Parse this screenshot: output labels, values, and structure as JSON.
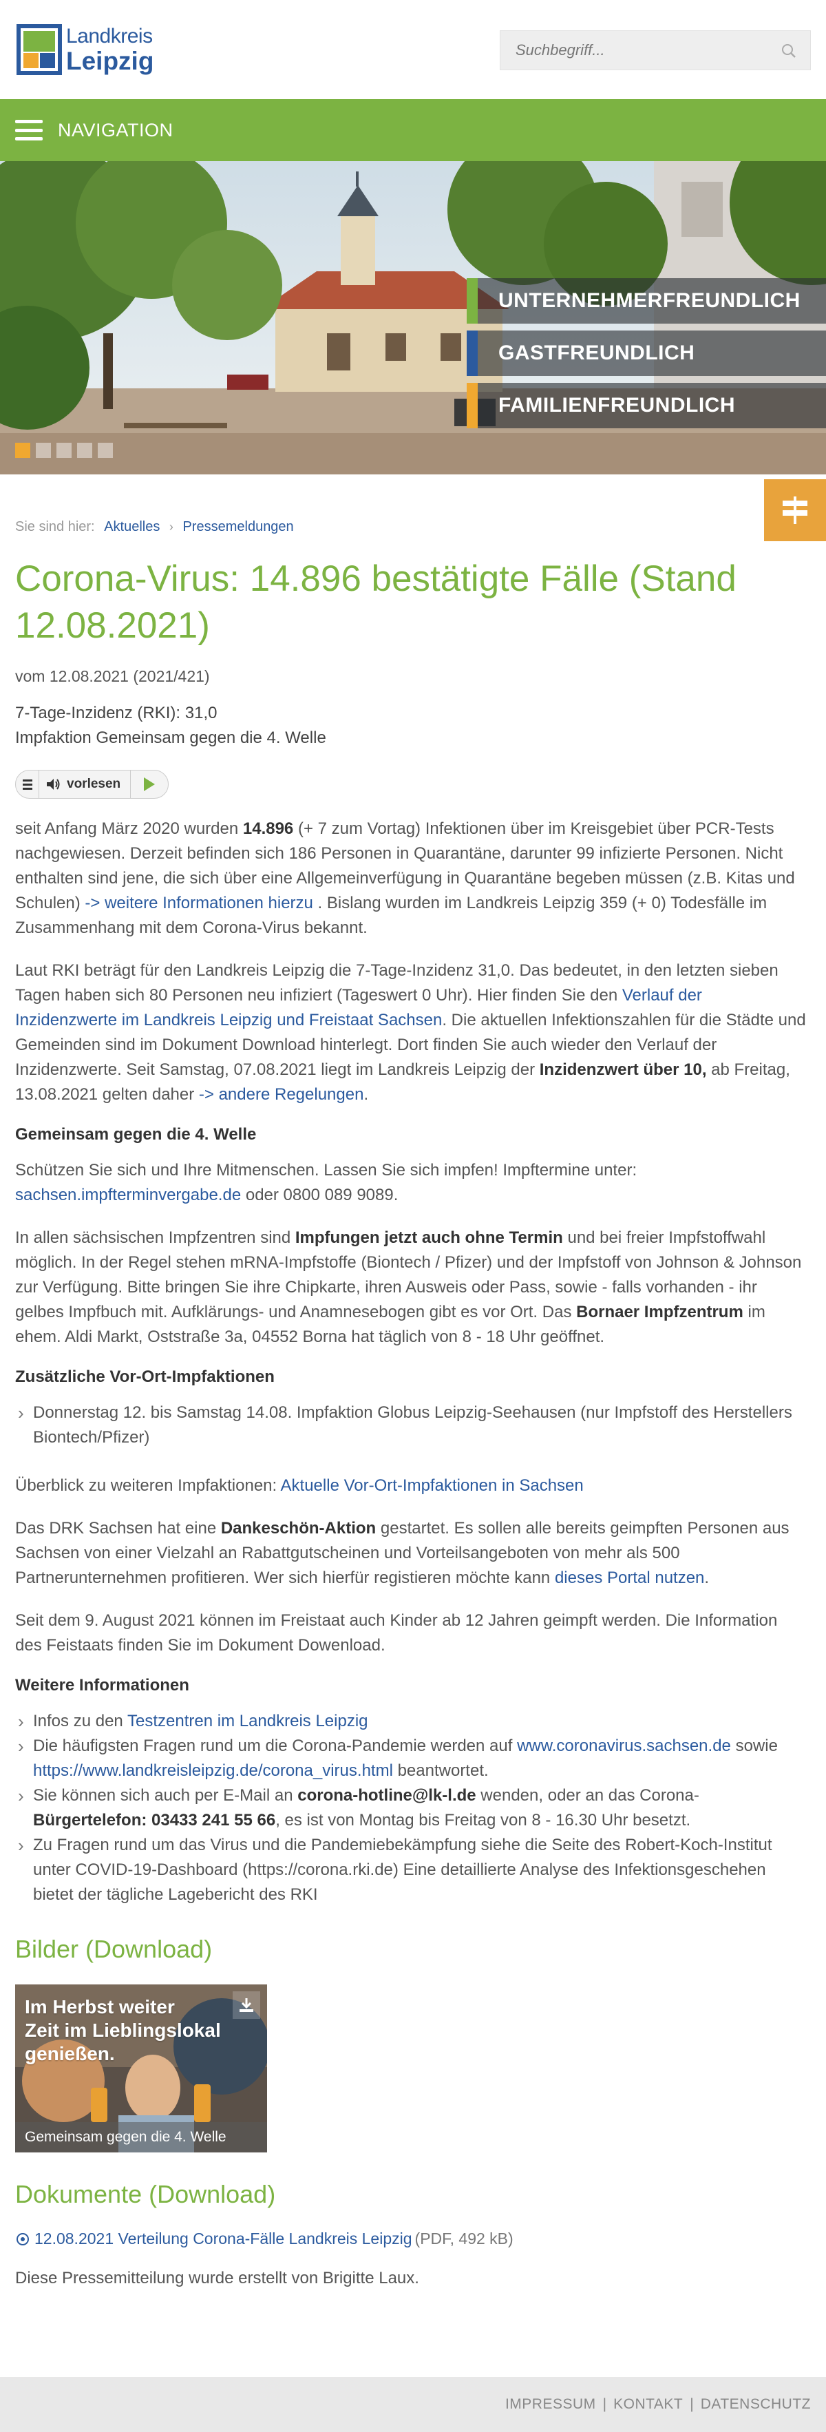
{
  "header": {
    "logo_line1": "Landkreis",
    "logo_line2": "Leipzig",
    "search_placeholder": "Suchbegriff..."
  },
  "nav": {
    "label": "NAVIGATION"
  },
  "hero": {
    "slogans": [
      {
        "text": "UNTERNEHMERFREUNDLICH",
        "color": "#7cb342"
      },
      {
        "text": "GASTFREUNDLICH",
        "color": "#2b5a9e"
      },
      {
        "text": "FAMILIENFREUNDLICH",
        "color": "#f0a830"
      }
    ],
    "slide_count": 5,
    "active_slide": 0
  },
  "breadcrumb": {
    "prefix": "Sie sind hier:",
    "items": [
      "Aktuelles",
      "Pressemeldungen"
    ],
    "separator": "›"
  },
  "article": {
    "title": "Corona-Virus: 14.896 bestätigte Fälle (Stand 12.08.2021)",
    "date": "vom 12.08.2021 (2021/421)",
    "sub1": "7-Tage-Inzidenz (RKI): 31,0",
    "sub2": "Impfaktion Gemeinsam gegen die 4. Welle",
    "readspeaker_label": "vorlesen",
    "p1": {
      "a": "seit Anfang März 2020 wurden ",
      "b": "14.896",
      "c": " (+ 7 zum Vortag) Infektionen über im Kreisgebiet über PCR-Tests nachgewiesen. Derzeit befinden sich 186 Personen in Quarantäne, darunter 99 infizierte Personen. Nicht enthalten sind jene, die sich über eine Allgemeinverfügung in Quarantäne begeben müssen (z.B. Kitas und Schulen) ",
      "link": "-> weitere Informationen hierzu",
      "d": " . Bislang wurden im Landkreis Leipzig 359 (+ 0) Todesfälle im Zusammenhang mit dem Corona-Virus bekannt."
    },
    "p2": {
      "a": "Laut RKI beträgt für den Landkreis Leipzig die 7-Tage-Inzidenz 31,0. Das bedeutet, in den letzten sieben Tagen haben sich 80 Personen neu infiziert (Tageswert 0 Uhr). Hier finden Sie den ",
      "link1": "Verlauf der Inzidenzwerte im Landkreis Leipzig und Freistaat Sachsen",
      "b": ". Die aktuellen Infektionszahlen für die Städte und Gemeinden sind im Dokument Download hinterlegt. Dort finden Sie auch wieder den Verlauf der Inzidenzwerte. Seit Samstag, 07.08.2021 liegt im Landkreis Leipzig der ",
      "bold": "Inzidenzwert über 10,",
      "c": " ab Freitag, 13.08.2021 gelten daher ",
      "link2": "-> andere Regelungen",
      "d": "."
    },
    "h_welle": "Gemeinsam gegen die 4. Welle",
    "p3": {
      "a": "Schützen Sie sich und Ihre Mitmenschen. Lassen Sie sich impfen! Impftermine unter: ",
      "link": "sachsen.impfterminvergabe.de",
      "b": " oder 0800 089 9089."
    },
    "p4": {
      "a": "In allen sächsischen Impfzentren sind ",
      "bold1": "Impfungen jetzt auch ohne Termin",
      "b": " und bei freier Impfstoffwahl möglich. In der Regel stehen mRNA-Impfstoffe (Biontech / Pfizer) und der Impfstoff von Johnson & Johnson zur Verfügung.  Bitte bringen Sie ihre Chipkarte, ihren Ausweis oder Pass, sowie - falls vorhanden - ihr gelbes Impfbuch mit. Aufklärungs- und Anamnesebogen gibt es vor Ort. Das ",
      "bold2": "Bornaer Impfzentrum",
      "c": " im ehem. Aldi Markt, Oststraße 3a, 04552 Borna hat täglich von 8 - 18 Uhr geöffnet."
    },
    "h_vorort": "Zusätzliche Vor-Ort-Impfaktionen",
    "vorort_item": "Donnerstag 12. bis Samstag 14.08. Impfaktion Globus Leipzig-Seehausen (nur Impfstoff des Herstellers Biontech/Pfizer)",
    "p5": {
      "a": "Überblick zu weiteren Impfaktionen:  ",
      "link": "Aktuelle Vor-Ort-Impfaktionen in Sachsen"
    },
    "p6": {
      "a": "Das DRK Sachsen hat eine ",
      "bold": "Dankeschön-Aktion",
      "b": " gestartet. Es sollen alle bereits geimpften Personen aus Sachsen von einer Vielzahl an Rabattgutscheinen und Vorteilsangeboten von mehr als 500 Partnerunternehmen profitieren. Wer sich hierfür registieren möchte kann ",
      "link": "dieses Portal nutzen",
      "c": "."
    },
    "p7": "Seit dem 9. August 2021 können im Freistaat auch Kinder ab 12 Jahren geimpft werden. Die Information des Feistaats finden Sie im Dokument Dowenload.",
    "h_weitere": "Weitere Informationen",
    "weitere": {
      "i1_a": "Infos zu den ",
      "i1_link": "Testzentren im Landkreis Leipzig",
      "i2_a": "Die häufigsten Fragen rund um die Corona-Pandemie werden auf ",
      "i2_link1": "www.coronavirus.sachsen.de",
      "i2_b": "  sowie ",
      "i2_link2": "https://www.landkreisleipzig.de/corona_virus.html",
      "i2_c": " beantwortet.",
      "i3_a": "Sie können sich auch per E-Mail an ",
      "i3_bold1": "corona-hotline@lk-l.de",
      "i3_b": " wenden, oder an das Corona-",
      "i3_bold2": "Bürgertelefon: 03433 241 55 66",
      "i3_c": ", es ist von Montag bis Freitag von 8 - 16.30 Uhr besetzt.",
      "i4": "Zu Fragen rund um das Virus und die Pandemiebekämpfung siehe die Seite des Robert-Koch-Institut unter COVID-19-Dashboard (https://corona.rki.de)  Eine detaillierte Analyse des Infektionsgeschehen bietet der tägliche Lagebericht des RKI"
    },
    "h_bilder": "Bilder (Download)",
    "image": {
      "promo_line1": "Im Herbst weiter",
      "promo_line2": "Zeit im Lieblingslokal",
      "promo_line3": "genießen.",
      "caption": "Gemeinsam gegen die 4. Welle"
    },
    "h_dokumente": "Dokumente (Download)",
    "document": {
      "link": "12.08.2021 Verteilung Corona-Fälle Landkreis Leipzig",
      "size": "(PDF, 492 kB)"
    },
    "author": "Diese Pressemitteilung wurde erstellt von Brigitte Laux."
  },
  "footer": {
    "links": [
      "IMPRESSUM",
      "KONTAKT",
      "DATENSCHUTZ"
    ],
    "divider": "|"
  }
}
